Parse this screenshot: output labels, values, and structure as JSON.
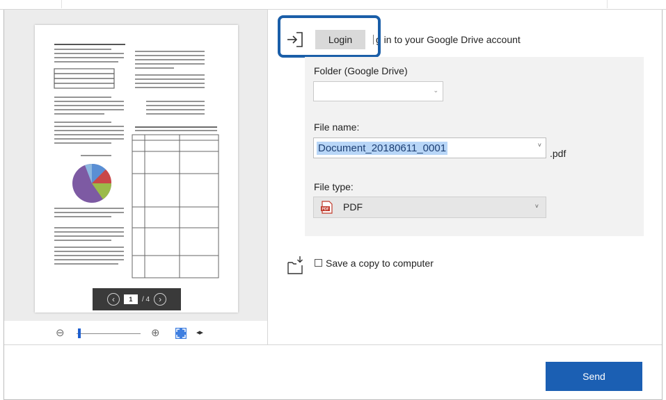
{
  "login": {
    "button_label": "Login",
    "description": "g in to your Google Drive account"
  },
  "folder": {
    "label": "Folder (Google Drive)",
    "value": ""
  },
  "file_name": {
    "label": "File name:",
    "value": "Document_20180611_0001",
    "extension": ".pdf"
  },
  "file_type": {
    "label": "File type:",
    "value": "PDF",
    "icon": "pdf-file-icon"
  },
  "save_copy": {
    "label": "Save a copy to computer",
    "checked": false
  },
  "preview": {
    "current_page": "1",
    "total_pages": "/ 4",
    "zoom_level": 0.02
  },
  "actions": {
    "send_label": "Send"
  },
  "colors": {
    "accent": "#1b5fb3",
    "highlight_border": "#1a5ea8",
    "selection": "#b8d6f7"
  }
}
